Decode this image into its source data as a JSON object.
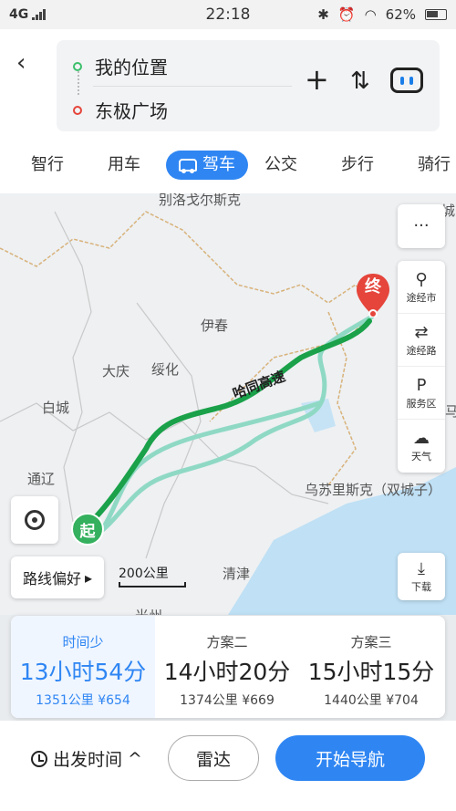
{
  "status_bar": {
    "network": "4G",
    "time": "22:18",
    "battery": "62%"
  },
  "search": {
    "from": "我的位置",
    "to": "东极广场"
  },
  "tabs": [
    {
      "label": "智行"
    },
    {
      "label": "用车"
    },
    {
      "label": "驾车",
      "active": true
    },
    {
      "label": "公交"
    },
    {
      "label": "步行"
    },
    {
      "label": "骑行"
    }
  ],
  "map": {
    "labels": {
      "city1": "别洛戈尔斯克",
      "city2": "伊春",
      "city3": "大庆",
      "city4": "绥化",
      "city5": "白城",
      "city6": "通辽",
      "city7": "乌苏里斯克（双城子）",
      "city8": "清津",
      "city9": "城",
      "city10": "马",
      "city11": "光州"
    },
    "road_label": "哈同高速",
    "scale": "200公里",
    "route_pref": "路线偏好",
    "start_pin": "起",
    "end_pin": "终",
    "side_tools": [
      {
        "label": "",
        "icon": "more-icon"
      },
      {
        "label": "途经市",
        "icon": "pin-icon"
      },
      {
        "label": "途经路",
        "icon": "road-icon"
      },
      {
        "label": "服务区",
        "icon": "service-icon"
      },
      {
        "label": "天气",
        "icon": "cloud-icon"
      }
    ],
    "download_label": "下载"
  },
  "plans": [
    {
      "tag": "时间少",
      "time": "13小时54分",
      "distance": "1351公里",
      "cost": "¥654"
    },
    {
      "tag": "方案二",
      "time": "14小时20分",
      "distance": "1374公里",
      "cost": "¥669"
    },
    {
      "tag": "方案三",
      "time": "15小时15分",
      "distance": "1440公里",
      "cost": "¥704"
    }
  ],
  "bottom": {
    "depart": "出发时间",
    "radar": "雷达",
    "navigate": "开始导航"
  },
  "colors": {
    "accent": "#2f86f3",
    "route_main": "#1aa14a",
    "route_alt": "#8fd9c4",
    "end_pin": "#e5453b",
    "start_pin": "#34b05e"
  }
}
